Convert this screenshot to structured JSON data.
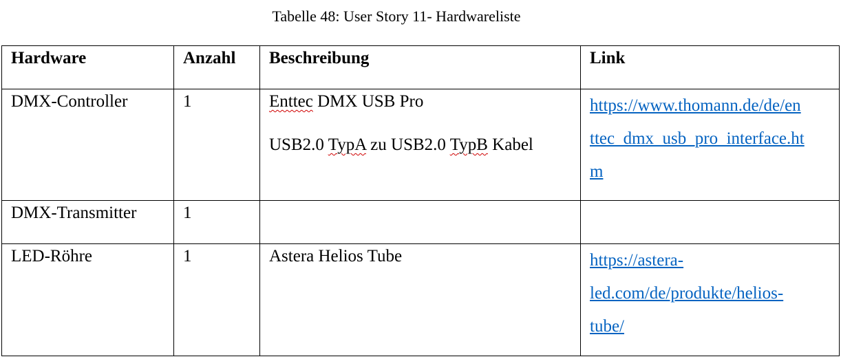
{
  "caption": "Tabelle 48: User Story 11- Hardwareliste",
  "table": {
    "headers": [
      "Hardware",
      "Anzahl",
      "Beschreibung",
      "Link"
    ],
    "rows": [
      {
        "hardware": "DMX-Controller",
        "anzahl": "1",
        "beschreibung": [
          "Enttec DMX USB Pro",
          "USB2.0 TypA zu USB2.0 TypB Kabel"
        ],
        "link_lines": [
          "https://www.thomann.de/de/en",
          "ttec_dmx_usb_pro_interface.ht",
          "m"
        ]
      },
      {
        "hardware": "DMX-Transmitter",
        "anzahl": "1",
        "beschreibung": [],
        "link_lines": []
      },
      {
        "hardware": "LED-Röhre",
        "anzahl": "1",
        "beschreibung": [
          "Astera Helios Tube"
        ],
        "link_lines": [
          "https://astera-",
          "led.com/de/produkte/helios-",
          "tube/"
        ]
      }
    ]
  },
  "colors": {
    "link": "#0563c1",
    "spellcheck": "#d00000"
  }
}
